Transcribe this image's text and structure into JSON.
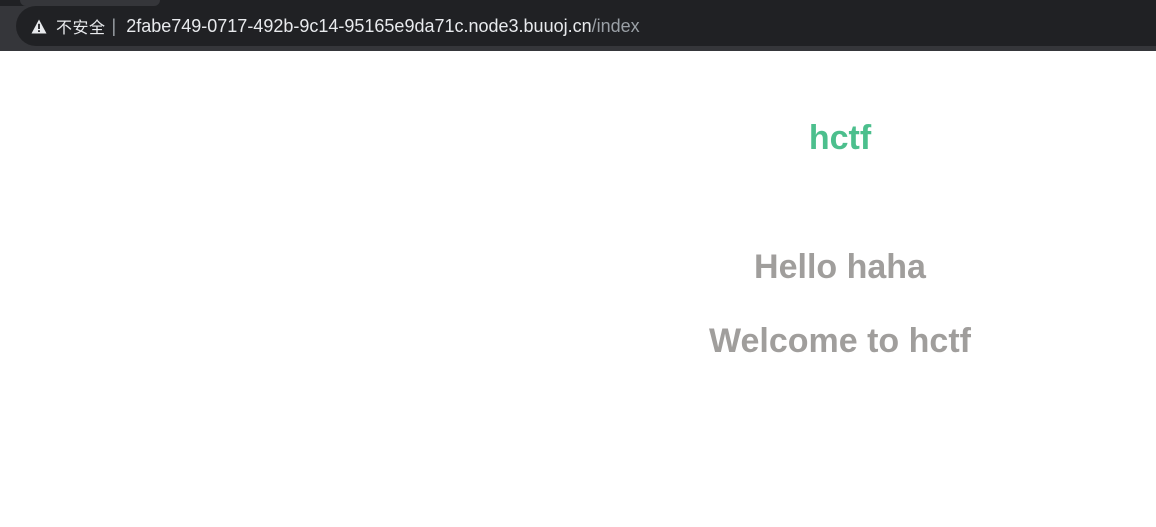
{
  "browser": {
    "security_label": "不安全",
    "divider": "|",
    "url_host": "2fabe749-0717-492b-9c14-95165e9da71c.node3.buuoj.cn",
    "url_path": "/index",
    "security_icon": "warning-triangle-icon"
  },
  "page": {
    "brand": "hctf",
    "greeting": "Hello haha",
    "welcome": "Welcome to hctf",
    "brand_color": "#4cbf8d",
    "text_color": "#a09e9c"
  }
}
